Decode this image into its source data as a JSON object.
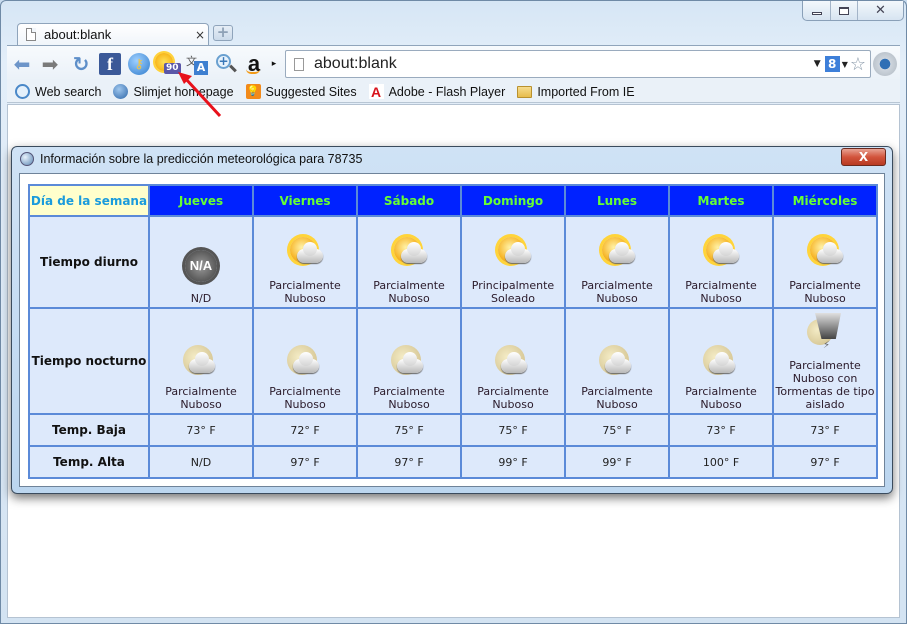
{
  "browser": {
    "window_controls": {
      "minimize": "minimize",
      "maximize": "maximize",
      "close": "close"
    },
    "tab": {
      "title": "about:blank",
      "close_glyph": "×",
      "new_tab_glyph": "+"
    },
    "toolbar": {
      "extensions": [
        {
          "name": "facebook-icon",
          "glyph": "f"
        },
        {
          "name": "key-icon",
          "glyph": "⚷"
        },
        {
          "name": "weather-extension-icon",
          "badge": "90"
        },
        {
          "name": "translate-icon",
          "glyph": "A"
        },
        {
          "name": "zoom-icon",
          "glyph": "+"
        },
        {
          "name": "amazon-icon",
          "glyph": "a"
        }
      ],
      "more_glyph": "▸",
      "address": {
        "value": "about:blank",
        "prefix": "about:",
        "host": "blank"
      },
      "search_engine_glyph": "8"
    },
    "bookmarks": [
      {
        "label": "Web search",
        "icon": "search"
      },
      {
        "label": "Slimjet homepage",
        "icon": "globe"
      },
      {
        "label": "Suggested Sites",
        "icon": "bulb"
      },
      {
        "label": "Adobe - Flash Player",
        "icon": "adobe"
      },
      {
        "label": "Imported From IE",
        "icon": "folder"
      }
    ]
  },
  "dialog": {
    "title": "Información sobre la predicción meteorológica para 78735",
    "close_glyph": "X",
    "table": {
      "corner_label": "Día de la semana",
      "days": [
        "Jueves",
        "Viernes",
        "Sábado",
        "Domingo",
        "Lunes",
        "Martes",
        "Miércoles"
      ],
      "rows": {
        "day": {
          "label": "Tiempo diurno",
          "conditions": [
            "N/D",
            "Parcialmente Nuboso",
            "Parcialmente Nuboso",
            "Principalmente Soleado",
            "Parcialmente Nuboso",
            "Parcialmente Nuboso",
            "Parcialmente Nuboso"
          ],
          "icons": [
            "na",
            "pc",
            "pc",
            "pc",
            "pc",
            "pc",
            "pc"
          ]
        },
        "night": {
          "label": "Tiempo nocturno",
          "conditions": [
            "Parcialmente Nuboso",
            "Parcialmente Nuboso",
            "Parcialmente Nuboso",
            "Parcialmente Nuboso",
            "Parcialmente Nuboso",
            "Parcialmente Nuboso",
            "Parcialmente Nuboso con Tormentas de tipo aislado"
          ],
          "icons": [
            "nt",
            "nt",
            "nt",
            "nt",
            "nt",
            "nt",
            "st"
          ]
        },
        "low": {
          "label": "Temp. Baja",
          "values": [
            "73° F",
            "72° F",
            "75° F",
            "75° F",
            "75° F",
            "73° F",
            "73° F"
          ]
        },
        "high": {
          "label": "Temp. Alta",
          "values": [
            "N/D",
            "97° F",
            "97° F",
            "99° F",
            "99° F",
            "100° F",
            "97° F"
          ]
        }
      },
      "na_icon_text": "N/A"
    }
  },
  "colors": {
    "day_header_bg": "#0022ff",
    "day_header_text": "#66ff33",
    "corner_bg": "#ffffcc",
    "corner_text": "#1a9bdc",
    "cell_bg": "#dde9fb",
    "grid": "#5b8ad8",
    "annotation_arrow": "#e8111b"
  }
}
